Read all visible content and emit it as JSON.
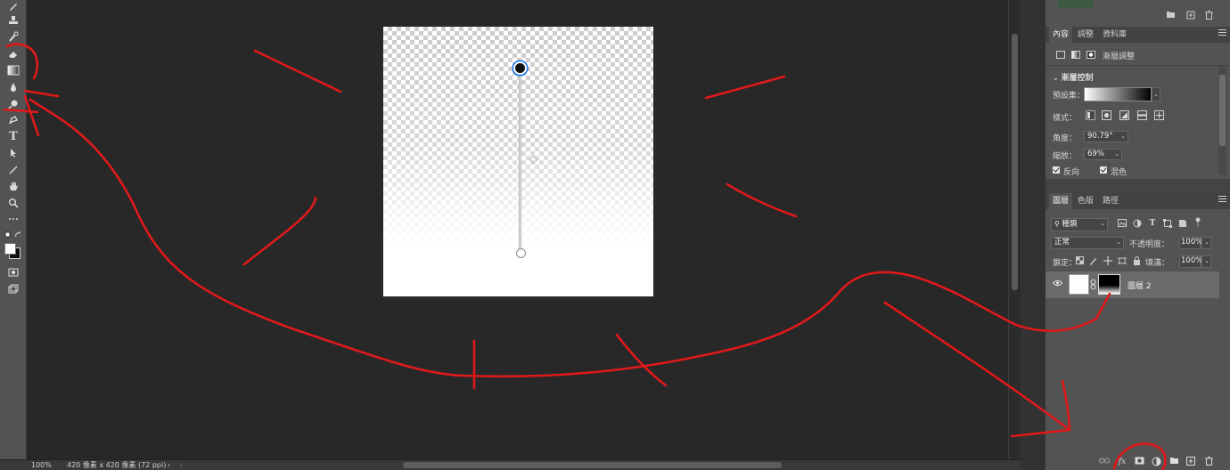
{
  "toolbar": {
    "tools": [
      "brush-icon",
      "stamp-icon",
      "history-brush-icon",
      "eraser-icon",
      "gradient-icon",
      "blur-drop-icon",
      "dodge-icon",
      "pen-icon",
      "type-icon",
      "path-select-icon",
      "line-icon",
      "hand-icon",
      "zoom-icon",
      "more-icon",
      "color-swap-icon",
      "quick-mask-icon",
      "screen-mode-icon"
    ],
    "type_glyph": "T"
  },
  "status": {
    "zoom": "100%",
    "info": "420 像素 x 420 像素 (72 ppi)",
    "arrow": "›",
    "scroll_left": "‹"
  },
  "properties": {
    "tabs": [
      "內容",
      "調整",
      "資料庫"
    ],
    "type_label": "漸層調整",
    "section_title": "漸層控制",
    "preset_label": "預設集：",
    "style_label": "樣式：",
    "angle_label": "角度：",
    "angle_value": "90.79°",
    "scale_label": "縮放：",
    "scale_value": "69%",
    "reverse_label": "反向",
    "dither_label": "混色"
  },
  "layers": {
    "tabs": [
      "圖層",
      "色版",
      "路徑"
    ],
    "filter_label": "種類",
    "blend_mode": "正常",
    "opacity_label": "不透明度：",
    "opacity_value": "100%",
    "lock_label": "鎖定：",
    "fill_label": "填滿：",
    "fill_value": "100%",
    "layer_name": "圖層 2",
    "footer_icons": [
      "link-icon",
      "fx-icon",
      "mask-icon",
      "adjustment-icon",
      "group-icon",
      "new-layer-icon",
      "trash-icon"
    ],
    "fx_label": "fx"
  },
  "colors": {
    "panel_bg": "#535353",
    "canvas_bg": "#282828",
    "annotation_red": "#e0191b",
    "accent_blue": "#1473e6"
  }
}
